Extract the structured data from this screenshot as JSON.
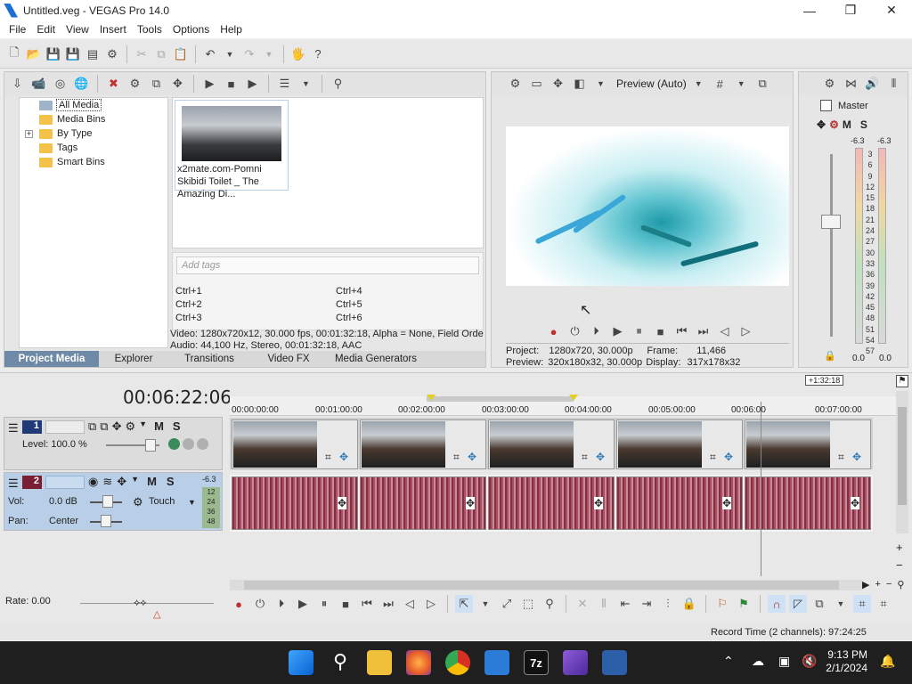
{
  "window": {
    "title": "Untitled.veg - VEGAS Pro 14.0",
    "minimize_glyph": "—",
    "maximize_glyph": "❐",
    "close_glyph": "✕"
  },
  "menu": [
    "File",
    "Edit",
    "View",
    "Insert",
    "Tools",
    "Options",
    "Help"
  ],
  "project_media": {
    "tree": [
      {
        "label": "All Media",
        "selected": true
      },
      {
        "label": "Media Bins"
      },
      {
        "label": "By Type",
        "expander": "+"
      },
      {
        "label": "Tags"
      },
      {
        "label": "Smart Bins"
      }
    ],
    "thumbnail_caption": "x2mate.com-Pomni Skibidi Toilet _ The Amazing Di...",
    "tags_placeholder": "Add tags",
    "shortcuts": [
      "Ctrl+1",
      "Ctrl+2",
      "Ctrl+3",
      "Ctrl+4",
      "Ctrl+5",
      "Ctrl+6"
    ],
    "media_info_video": "Video: 1280x720x12, 30.000 fps, 00:01:32:18, Alpha = None, Field Orde",
    "media_info_audio": "Audio: 44,100 Hz, Stereo, 00:01:32:18, AAC"
  },
  "tabs": [
    "Project Media",
    "Explorer",
    "Transitions",
    "Video FX",
    "Media Generators"
  ],
  "preview": {
    "mode_label": "Preview (Auto)",
    "project_label": "Project:",
    "project_value": "1280x720, 30.000p",
    "preview_label": "Preview:",
    "preview_value": "320x180x32, 30.000p",
    "frame_label": "Frame:",
    "frame_value": "11,466",
    "display_label": "Display:",
    "display_value": "317x178x32"
  },
  "master": {
    "title": "Master",
    "peak_left": "-6.3",
    "peak_right": "-6.3",
    "scale": [
      "3",
      "6",
      "9",
      "12",
      "15",
      "18",
      "21",
      "24",
      "27",
      "30",
      "33",
      "36",
      "39",
      "42",
      "45",
      "48",
      "51",
      "54",
      "57"
    ],
    "bottom_left": "0.0",
    "bottom_right": "0.0"
  },
  "timeline": {
    "timecode": "00:06:22:06",
    "loop_length": "+1:32:18",
    "ruler": [
      "00:00:00:00",
      "00:01:00:00",
      "00:02:00:00",
      "00:03:00:00",
      "00:04:00:00",
      "00:05:00:00",
      "00:06:00",
      "00:07:00:00"
    ],
    "video_track": {
      "number": "1",
      "level_label": "Level: 100.0 %"
    },
    "audio_track": {
      "number": "2",
      "peak": "-6.3",
      "vol_label": "Vol:",
      "vol_value": "0.0 dB",
      "pan_label": "Pan:",
      "pan_value": "Center",
      "automation_mode": "Touch",
      "mini_scale": [
        "12",
        "24",
        "36",
        "48"
      ]
    },
    "m_label": "M",
    "s_label": "S",
    "rate_label": "Rate: 0.00",
    "record_time": "Record Time (2 channels): 97:24:25"
  },
  "taskbar": {
    "time": "9:13 PM",
    "date": "2/1/2024"
  }
}
